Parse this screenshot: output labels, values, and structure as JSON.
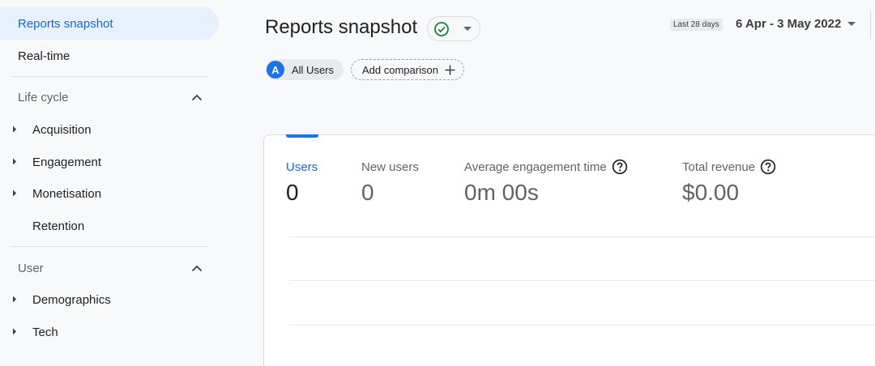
{
  "sidebar": {
    "reports_snapshot": "Reports snapshot",
    "realtime": "Real-time",
    "lifecycle": {
      "title": "Life cycle",
      "items": [
        "Acquisition",
        "Engagement",
        "Monetisation",
        "Retention"
      ]
    },
    "user": {
      "title": "User",
      "items": [
        "Demographics",
        "Tech"
      ]
    }
  },
  "header": {
    "title": "Reports snapshot",
    "date_label": "Last 28 days",
    "date_range": "6 Apr - 3 May 2022"
  },
  "chips": {
    "segment_letter": "A",
    "segment_label": "All Users",
    "add_comparison": "Add comparison"
  },
  "metrics": [
    {
      "label": "Users",
      "value": "0"
    },
    {
      "label": "New users",
      "value": "0"
    },
    {
      "label": "Average engagement time",
      "value": "0m 00s"
    },
    {
      "label": "Total revenue",
      "value": "$0.00"
    }
  ],
  "colors": {
    "accent": "#1a73e8",
    "active_bg": "#e8f0fe",
    "status_green": "#188038"
  }
}
